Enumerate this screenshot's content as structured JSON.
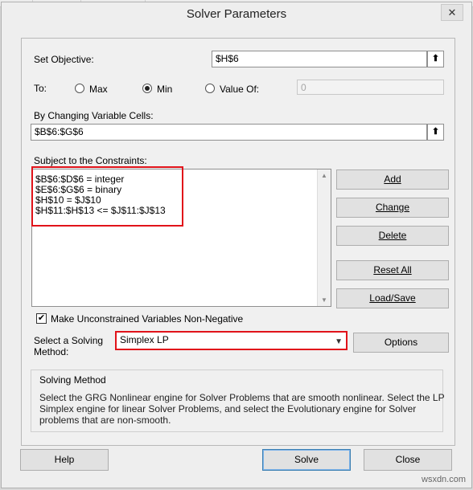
{
  "window": {
    "title": "Solver Parameters",
    "close_glyph": "✕"
  },
  "objective": {
    "label": "Set Objective:",
    "value": "$H$6"
  },
  "to": {
    "label": "To:",
    "options": [
      {
        "label": "Max",
        "selected": false
      },
      {
        "label": "Min",
        "selected": true
      },
      {
        "label": "Value Of:",
        "selected": false
      }
    ],
    "value_of": "0"
  },
  "changing": {
    "label": "By Changing Variable Cells:",
    "value": "$B$6:$G$6"
  },
  "constraints": {
    "label": "Subject to the Constraints:",
    "items": [
      "$B$6:$D$6 = integer",
      "$E$6:$G$6 = binary",
      "$H$10 = $J$10",
      "$H$11:$H$13 <= $J$11:$J$13"
    ],
    "buttons": [
      "Add",
      "Change",
      "Delete",
      "Reset All",
      "Load/Save"
    ]
  },
  "nonneg": {
    "label": "Make Unconstrained Variables Non-Negative",
    "checked": true
  },
  "method": {
    "label_line1": "Select a Solving",
    "label_line2": "Method:",
    "value": "Simplex LP",
    "options_button": "Options"
  },
  "description": {
    "heading": "Solving Method",
    "line1": "Select the GRG Nonlinear engine for Solver Problems that are smooth nonlinear. Select the LP",
    "line2": "Simplex engine for linear Solver Problems, and select the Evolutionary engine for Solver",
    "line3": "problems that are non-smooth."
  },
  "footer": {
    "help": "Help",
    "solve": "Solve",
    "close": "Close"
  },
  "watermark": "wsxdn.com",
  "colors": {
    "highlight": "#e1131a",
    "default_button": "#3c7fb1"
  }
}
